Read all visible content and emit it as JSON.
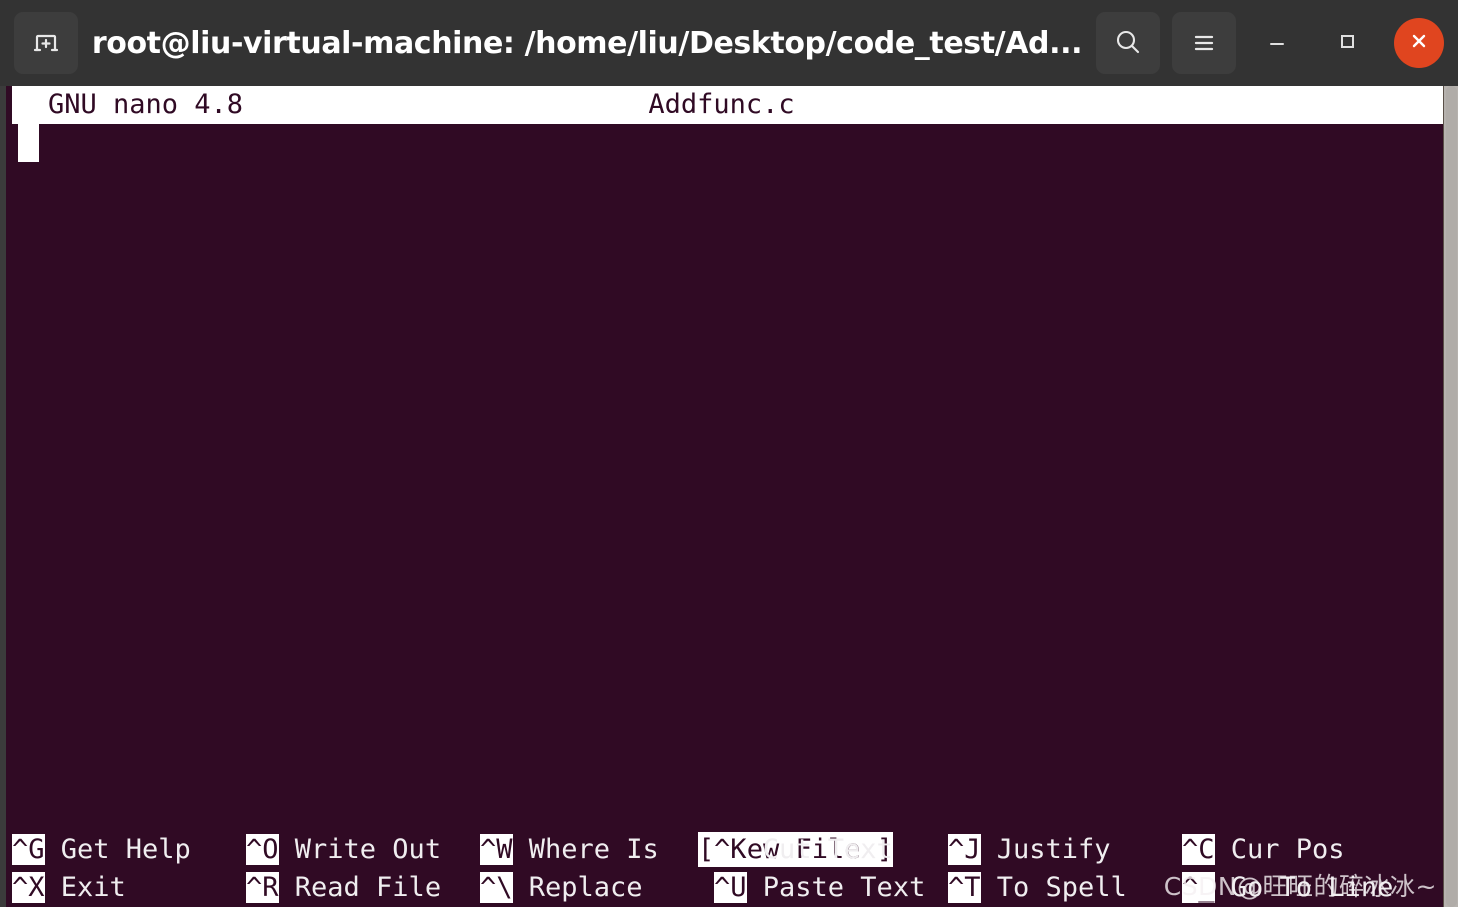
{
  "window": {
    "title": "root@liu-virtual-machine: /home/liu/Desktop/code_test/Ad...",
    "new_tab_icon": "new-terminal-tab-icon",
    "search_icon": "search-icon",
    "menu_icon": "hamburger-menu-icon",
    "minimize_icon": "minimize-icon",
    "maximize_icon": "maximize-icon",
    "close_icon": "close-icon",
    "accent_close": "#e0451f",
    "titlebar_bg": "#333333"
  },
  "terminal": {
    "bg": "#300a24",
    "fg": "#f0eef0"
  },
  "nano": {
    "version_label": "GNU nano 4.8",
    "filename": "Addfunc.c",
    "buffer_text": "",
    "status": "[ New File ]",
    "shortcuts_row1": [
      {
        "key": "^G",
        "label": " Get Help"
      },
      {
        "key": "^O",
        "label": " Write Out"
      },
      {
        "key": "^W",
        "label": " Where Is"
      },
      {
        "key": "^K",
        "label": " Cut Text"
      },
      {
        "key": "^J",
        "label": " Justify"
      },
      {
        "key": "^C",
        "label": " Cur Pos"
      }
    ],
    "shortcuts_row2": [
      {
        "key": "^X",
        "label": " Exit"
      },
      {
        "key": "^R",
        "label": " Read File"
      },
      {
        "key": "^\\",
        "label": " Replace"
      },
      {
        "key": "^U",
        "label": " Paste Text"
      },
      {
        "key": "^T",
        "label": " To Spell"
      },
      {
        "key": "^_",
        "label": " Go To Line"
      }
    ]
  },
  "watermark": {
    "text": "CSDN@旺旺的碎冰冰~"
  }
}
